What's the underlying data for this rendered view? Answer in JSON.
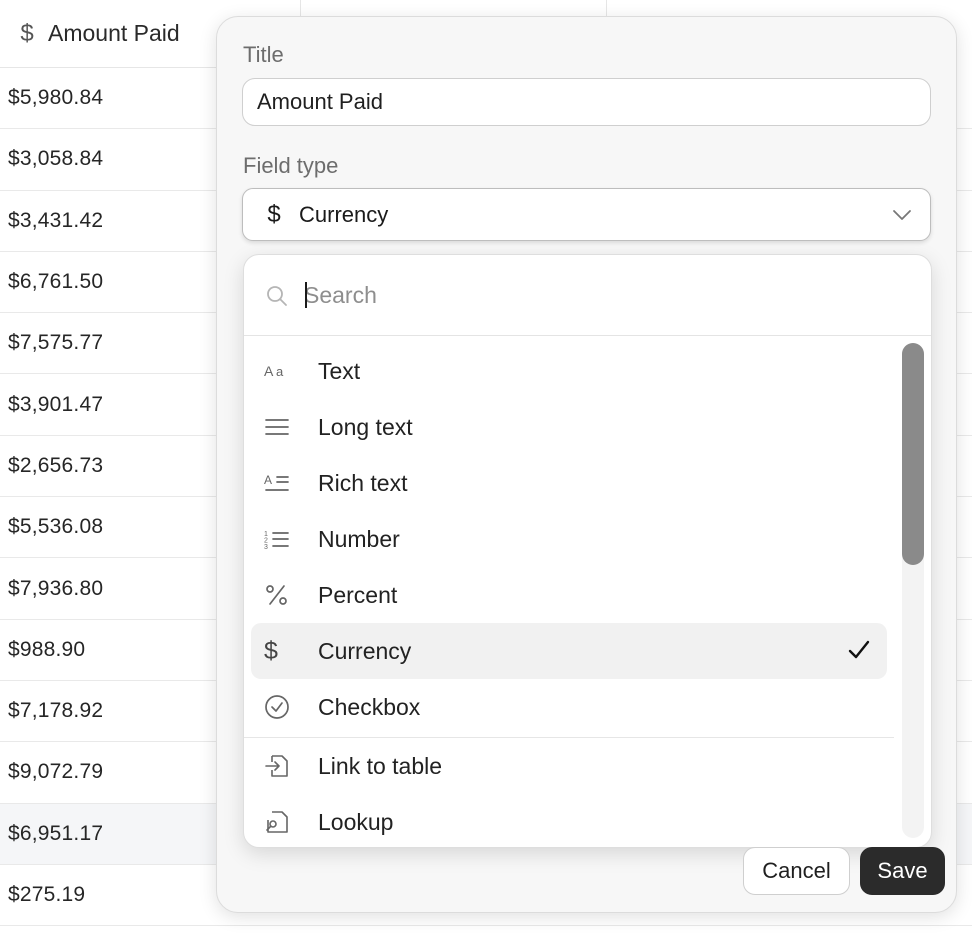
{
  "table": {
    "column_header": "Amount Paid",
    "column_icon": "dollar-icon",
    "rows": [
      "$5,980.84",
      "$3,058.84",
      "$3,431.42",
      "$6,761.50",
      "$7,575.77",
      "$3,901.47",
      "$2,656.73",
      "$5,536.08",
      "$7,936.80",
      "$988.90",
      "$7,178.92",
      "$9,072.79",
      "$6,951.17",
      "$275.19"
    ],
    "highlighted_row_index": 12
  },
  "editor": {
    "title_label": "Title",
    "title_value": "Amount Paid",
    "field_type_label": "Field type",
    "field_type_value": "Currency",
    "field_type_icon": "dollar-icon",
    "search_placeholder": "Search",
    "items": [
      {
        "label": "Text",
        "icon": "text-aa-icon"
      },
      {
        "label": "Long text",
        "icon": "long-text-icon"
      },
      {
        "label": "Rich text",
        "icon": "rich-text-icon"
      },
      {
        "label": "Number",
        "icon": "number-list-icon"
      },
      {
        "label": "Percent",
        "icon": "percent-icon"
      },
      {
        "label": "Currency",
        "icon": "dollar-icon",
        "selected": true
      },
      {
        "label": "Checkbox",
        "icon": "checkbox-circle-icon"
      },
      {
        "label": "Link to table",
        "icon": "link-table-icon"
      },
      {
        "label": "Lookup",
        "icon": "lookup-icon"
      }
    ],
    "cancel_label": "Cancel",
    "save_label": "Save"
  },
  "colors": {
    "accent_dark": "#2b2b2b",
    "panel_bg": "#f7f7f7",
    "selected_bg": "#f1f1f1",
    "scroll_thumb": "#8a8a8a"
  }
}
